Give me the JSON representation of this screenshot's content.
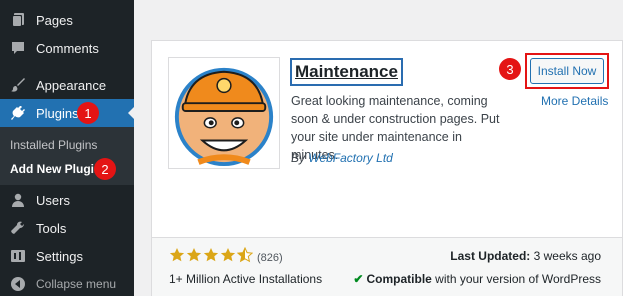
{
  "sidebar": {
    "items": [
      {
        "label": "Pages",
        "icon": "pages-icon"
      },
      {
        "label": "Comments",
        "icon": "comments-icon"
      },
      {
        "label": "Appearance",
        "icon": "appearance-icon"
      },
      {
        "label": "Plugins",
        "icon": "plugins-icon"
      },
      {
        "label": "Users",
        "icon": "users-icon"
      },
      {
        "label": "Tools",
        "icon": "tools-icon"
      },
      {
        "label": "Settings",
        "icon": "settings-icon"
      }
    ],
    "submenu": [
      "Installed Plugins",
      "Add New Plugin"
    ],
    "collapse_label": "Collapse menu"
  },
  "badges": {
    "one": "1",
    "two": "2",
    "three": "3"
  },
  "plugin": {
    "title": "Maintenance",
    "description": "Great looking maintenance, coming soon & under construction pages. Put your site under maintenance in minutes.",
    "author_prefix": "By ",
    "author": "WebFactory Ltd",
    "install_label": "Install Now",
    "more_details": "More Details",
    "rating": 4.5,
    "rating_count": "(826)",
    "installs": "1+ Million Active Installations",
    "last_updated_label": "Last Updated:",
    "last_updated_value": " 3 weeks ago",
    "compatible_label": "Compatible",
    "compatible_suffix": " with your version of WordPress"
  },
  "colors": {
    "accent": "#2271b1",
    "highlight": "#e41414",
    "sidebar": "#1d2327",
    "star": "#dba617"
  }
}
